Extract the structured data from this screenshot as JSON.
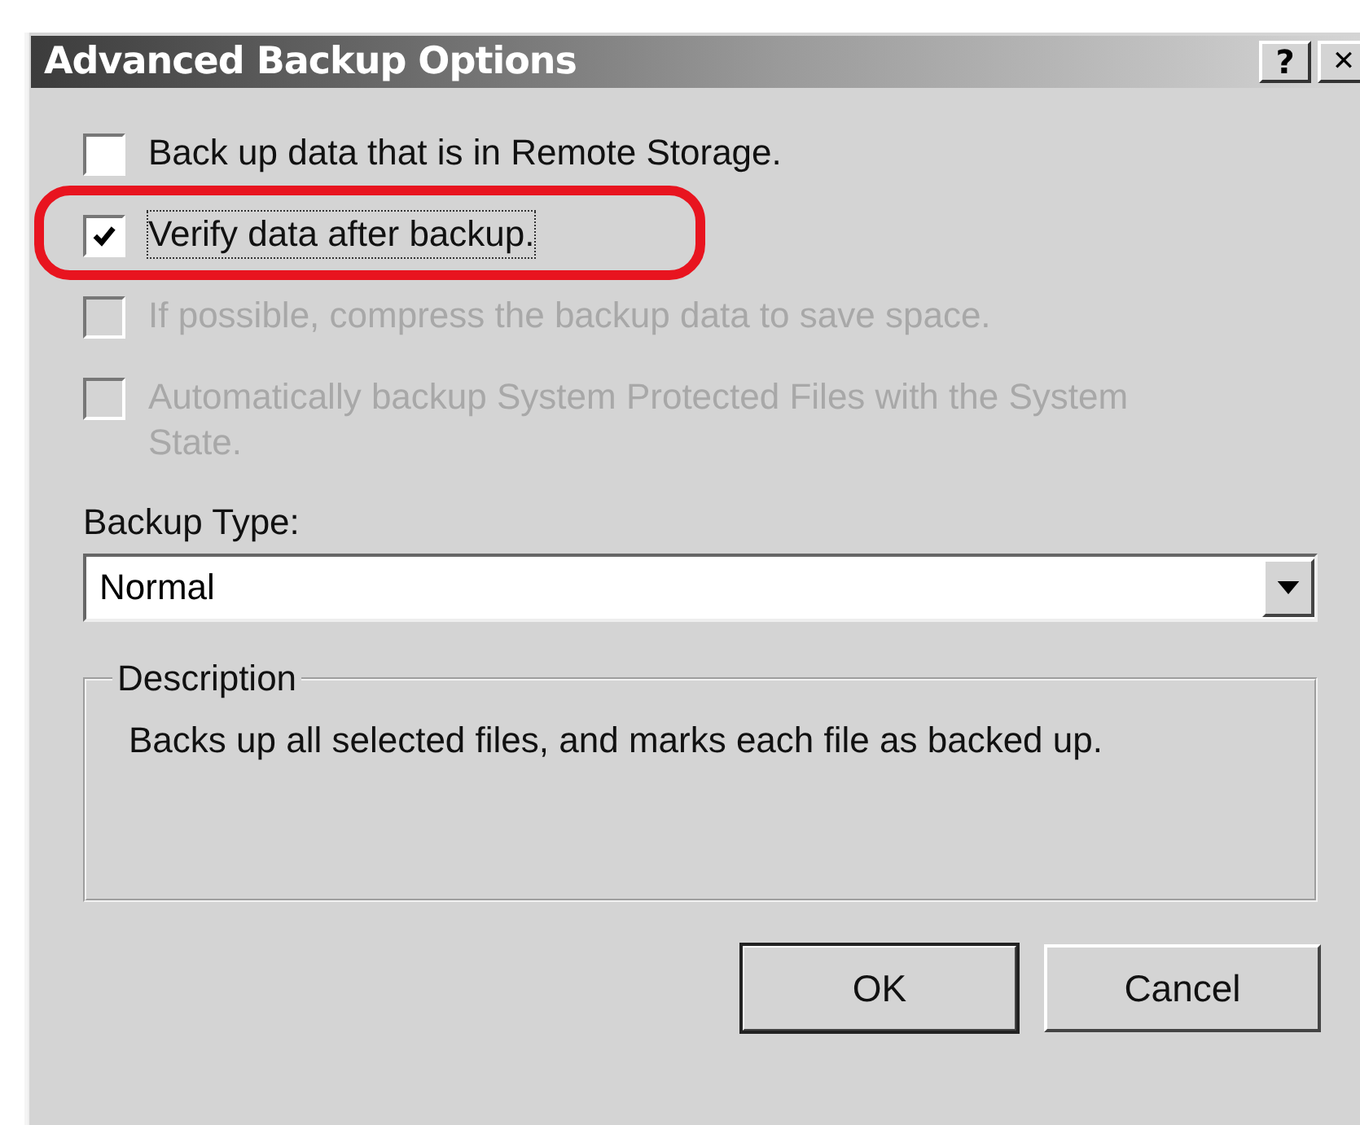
{
  "window": {
    "title": "Advanced Backup Options",
    "title_buttons": [
      {
        "kind": "help",
        "label": "?"
      },
      {
        "kind": "close",
        "label": "✕"
      }
    ]
  },
  "options": [
    {
      "label": "Back up data that is in Remote Storage.",
      "checked": false,
      "disabled": false,
      "highlighted": false
    },
    {
      "label": "Verify data after backup.",
      "checked": true,
      "disabled": false,
      "highlighted": true
    },
    {
      "label": "If possible, compress the backup data to save space.",
      "checked": false,
      "disabled": true,
      "highlighted": false
    },
    {
      "label": "Automatically backup System Protected Files with the System State.",
      "checked": false,
      "disabled": true,
      "highlighted": false
    }
  ],
  "backup_type": {
    "label": "Backup Type:",
    "value": "Normal"
  },
  "description": {
    "title": "Description",
    "text": "Backs up all selected files, and marks each file as backed up."
  },
  "buttons": [
    {
      "label": "OK",
      "default": true
    },
    {
      "label": "Cancel",
      "default": false
    }
  ]
}
